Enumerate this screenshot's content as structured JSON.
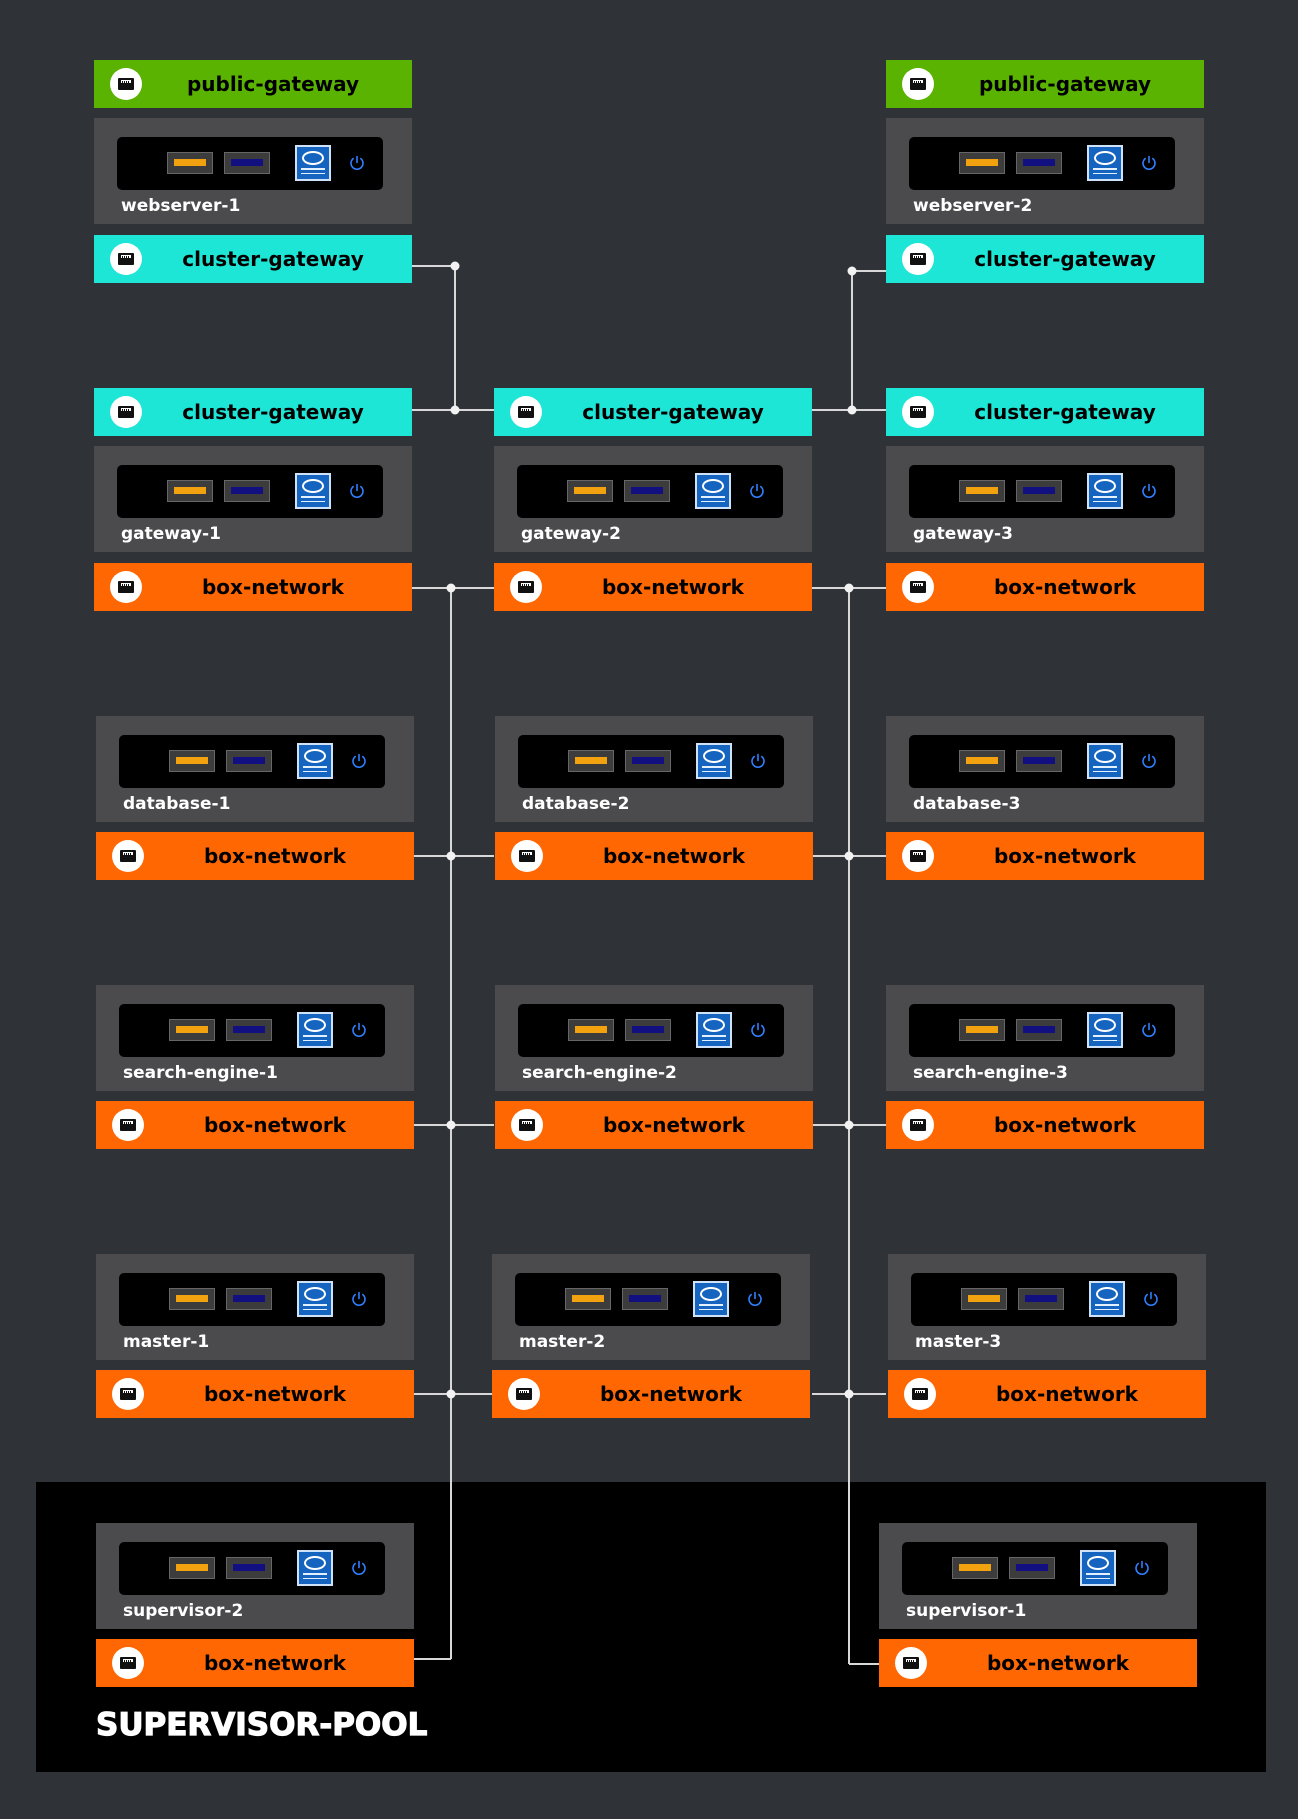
{
  "pool": {
    "title": "SUPERVISOR-POOL"
  },
  "nodes": [
    {
      "id": "webserver-1",
      "name": "webserver-1",
      "col": 0,
      "row": "web",
      "top_net": {
        "type": "public",
        "label": "public-gateway"
      },
      "bottom_net": {
        "type": "cluster",
        "label": "cluster-gateway"
      }
    },
    {
      "id": "webserver-2",
      "name": "webserver-2",
      "col": 2,
      "row": "web",
      "top_net": {
        "type": "public",
        "label": "public-gateway"
      },
      "bottom_net": {
        "type": "cluster",
        "label": "cluster-gateway"
      }
    },
    {
      "id": "gateway-1",
      "name": "gateway-1",
      "col": 0,
      "row": "gateway",
      "top_net": {
        "type": "cluster",
        "label": "cluster-gateway"
      },
      "bottom_net": {
        "type": "box",
        "label": "box-network"
      }
    },
    {
      "id": "gateway-2",
      "name": "gateway-2",
      "col": 1,
      "row": "gateway",
      "top_net": {
        "type": "cluster",
        "label": "cluster-gateway"
      },
      "bottom_net": {
        "type": "box",
        "label": "box-network"
      }
    },
    {
      "id": "gateway-3",
      "name": "gateway-3",
      "col": 2,
      "row": "gateway",
      "top_net": {
        "type": "cluster",
        "label": "cluster-gateway"
      },
      "bottom_net": {
        "type": "box",
        "label": "box-network"
      }
    },
    {
      "id": "database-1",
      "name": "database-1",
      "col": 0,
      "row": "database",
      "bottom_net": {
        "type": "box",
        "label": "box-network"
      }
    },
    {
      "id": "database-2",
      "name": "database-2",
      "col": 1,
      "row": "database",
      "bottom_net": {
        "type": "box",
        "label": "box-network"
      }
    },
    {
      "id": "database-3",
      "name": "database-3",
      "col": 2,
      "row": "database",
      "bottom_net": {
        "type": "box",
        "label": "box-network"
      }
    },
    {
      "id": "search-engine-1",
      "name": "search-engine-1",
      "col": 0,
      "row": "search",
      "bottom_net": {
        "type": "box",
        "label": "box-network"
      }
    },
    {
      "id": "search-engine-2",
      "name": "search-engine-2",
      "col": 1,
      "row": "search",
      "bottom_net": {
        "type": "box",
        "label": "box-network"
      }
    },
    {
      "id": "search-engine-3",
      "name": "search-engine-3",
      "col": 2,
      "row": "search",
      "bottom_net": {
        "type": "box",
        "label": "box-network"
      }
    },
    {
      "id": "master-1",
      "name": "master-1",
      "col": 0,
      "row": "master",
      "bottom_net": {
        "type": "box",
        "label": "box-network"
      }
    },
    {
      "id": "master-2",
      "name": "master-2",
      "col": 1,
      "row": "master",
      "bottom_net": {
        "type": "box",
        "label": "box-network"
      }
    },
    {
      "id": "master-3",
      "name": "master-3",
      "col": 2,
      "row": "master",
      "bottom_net": {
        "type": "box",
        "label": "box-network"
      }
    },
    {
      "id": "supervisor-2",
      "name": "supervisor-2",
      "col": 0,
      "row": "supervisor",
      "bottom_net": {
        "type": "box",
        "label": "box-network"
      }
    },
    {
      "id": "supervisor-1",
      "name": "supervisor-1",
      "col": 2,
      "row": "supervisor",
      "bottom_net": {
        "type": "box",
        "label": "box-network"
      }
    }
  ],
  "colors": {
    "background": "#2f3237",
    "host": "#4b4b4d",
    "public_gateway": "#5ab300",
    "cluster_gateway": "#1ee6d6",
    "box_network": "#ff6703",
    "connector": "#d8d8d8"
  }
}
